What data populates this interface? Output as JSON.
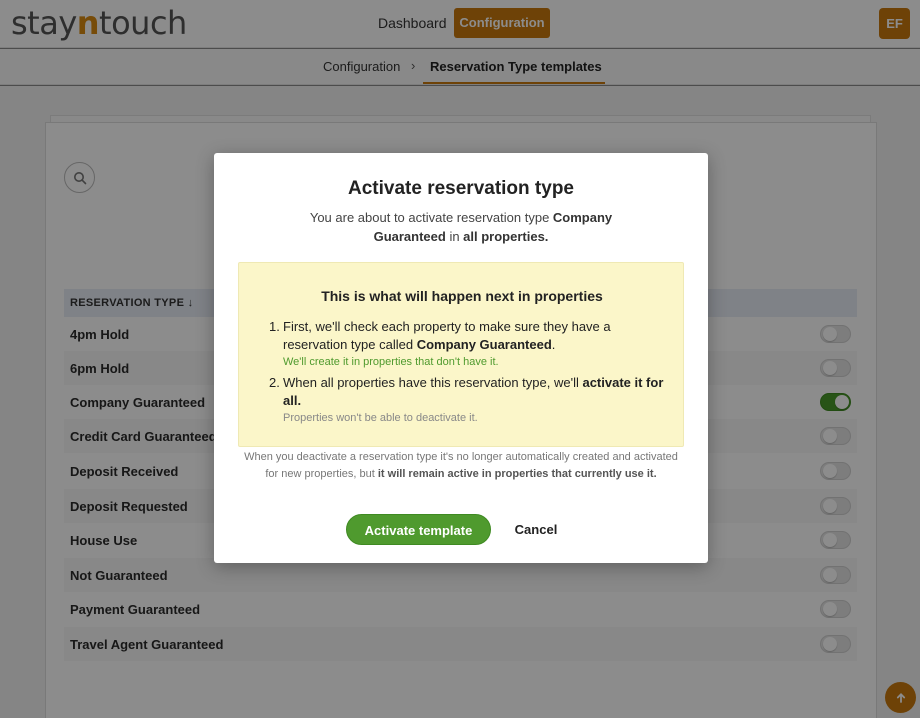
{
  "header": {
    "logo_prefix": "stay",
    "logo_accent": "n",
    "logo_suffix": "touch",
    "nav_dashboard": "Dashboard",
    "nav_configuration": "Configuration",
    "user_initials": "EF"
  },
  "breadcrumb": {
    "root": "Configuration",
    "separator": "›",
    "current": "Reservation Type templates"
  },
  "table": {
    "column_header": "RESERVATION TYPE ↓",
    "rows": [
      {
        "label": "4pm Hold",
        "active": false
      },
      {
        "label": "6pm Hold",
        "active": false
      },
      {
        "label": "Company Guaranteed",
        "active": true
      },
      {
        "label": "Credit Card Guaranteed",
        "active": false
      },
      {
        "label": "Deposit Received",
        "active": false
      },
      {
        "label": "Deposit Requested",
        "active": false
      },
      {
        "label": "House Use",
        "active": false
      },
      {
        "label": "Not Guaranteed",
        "active": false
      },
      {
        "label": "Payment Guaranteed",
        "active": false
      },
      {
        "label": "Travel Agent Guaranteed",
        "active": false
      }
    ]
  },
  "modal": {
    "title": "Activate reservation type",
    "desc_pre": "You are about to activate reservation type ",
    "desc_type": "Company Guaranteed",
    "desc_mid": " in ",
    "desc_scope": "all properties.",
    "info_title": "This is what will happen next in properties",
    "step1_num": "1.",
    "step1_text": "First, we'll check each property to make sure they have a reservation type called ",
    "step1_bold": "Company Guaranteed",
    "step1_end": ".",
    "step1_note": "We'll create it in properties that don't have it.",
    "step2_num": "2.",
    "step2_text": "When all properties have this reservation type, we'll ",
    "step2_bold": "activate it for all.",
    "step2_note": "Properties won't be able to deactivate it.",
    "footnote_text": "When you deactivate a reservation type it's no longer automatically created and activated for new properties, but ",
    "footnote_bold": "it will remain active in properties that currently use it.",
    "activate_label": "Activate template",
    "cancel_label": "Cancel"
  },
  "colors": {
    "brand": "#c8780d",
    "primary_green": "#4f9a2e",
    "info_bg": "#fbf6c9"
  }
}
